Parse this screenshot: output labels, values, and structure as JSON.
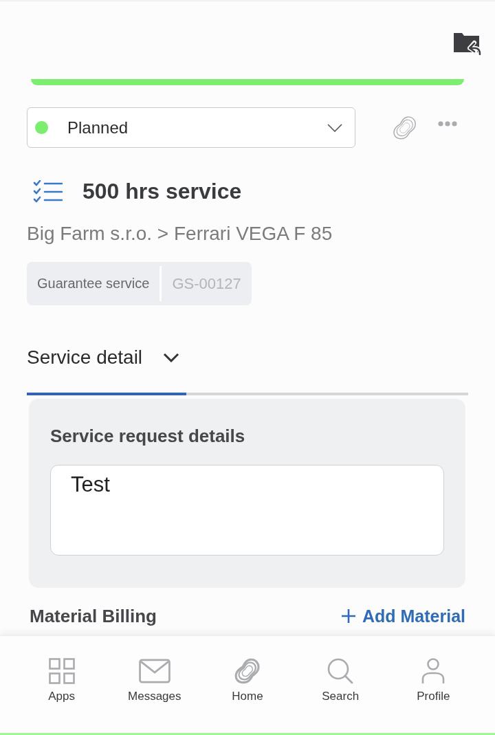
{
  "status": {
    "label": "Planned"
  },
  "work_order": {
    "title": "500 hrs service",
    "breadcrumb": "Big Farm s.r.o. > Ferrari VEGA F 85",
    "tags": [
      {
        "kind": "type",
        "text": "Guarantee service"
      },
      {
        "kind": "id",
        "text": "GS-00127"
      }
    ]
  },
  "tabs": [
    {
      "label": "Service detail",
      "selected": true
    }
  ],
  "service_request": {
    "heading": "Service request details",
    "value": "Test"
  },
  "material_billing": {
    "heading": "Material Billing",
    "add_link": "Add Material"
  },
  "bottom_nav": [
    {
      "label": "Apps"
    },
    {
      "label": "Messages"
    },
    {
      "label": "Home"
    },
    {
      "label": "Search"
    },
    {
      "label": "Profile"
    }
  ]
}
